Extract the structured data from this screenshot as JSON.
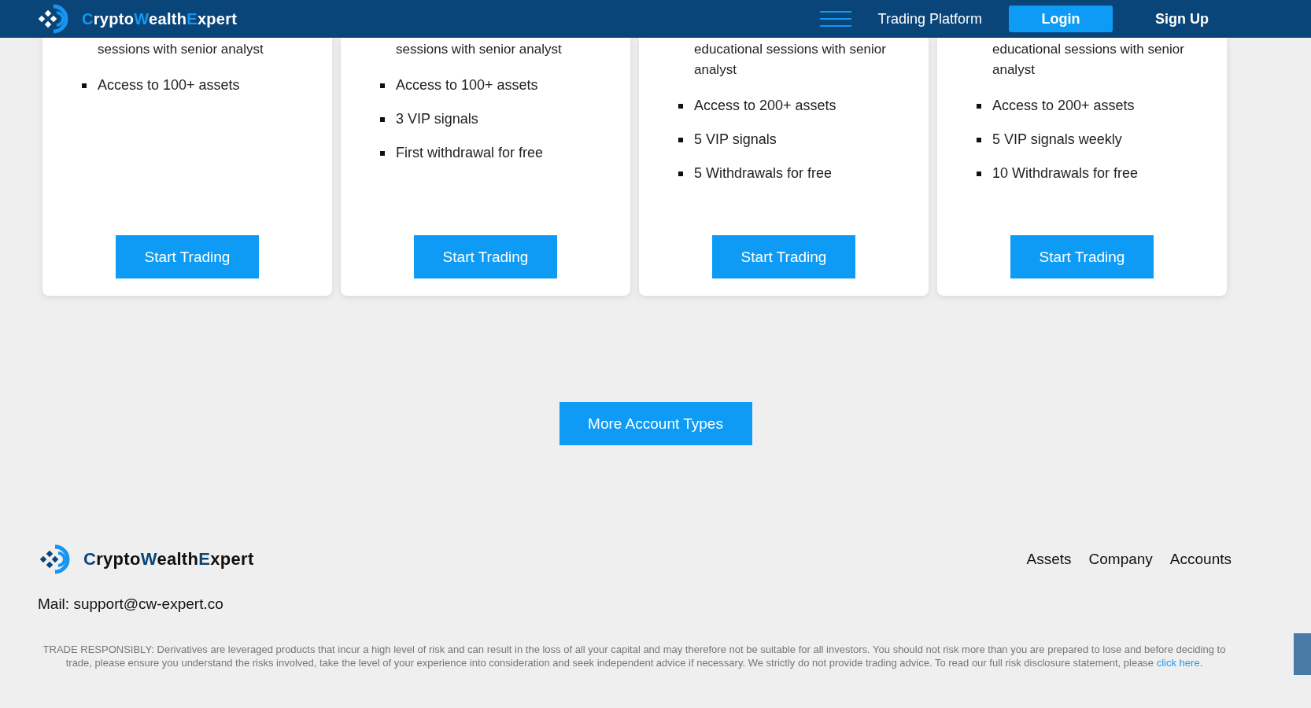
{
  "header": {
    "brand": {
      "parts": [
        "C",
        "rypto",
        "W",
        "ealth",
        "E",
        "xpert"
      ]
    },
    "nav": [
      {
        "label": "Trading Platform",
        "kind": "link"
      },
      {
        "label": "Login",
        "kind": "button"
      },
      {
        "label": "Sign Up",
        "kind": "link"
      }
    ]
  },
  "plans": [
    {
      "cut_text": "sessions with senior analyst",
      "features": [
        "Access to 100+ assets"
      ],
      "button": "Start Trading"
    },
    {
      "cut_text": "sessions with senior analyst",
      "features": [
        "Access to 100+ assets",
        "3 VIP signals",
        "First withdrawal for free"
      ],
      "button": "Start Trading"
    },
    {
      "cut_text": "educational sessions with senior analyst",
      "features": [
        "Access to 200+ assets",
        "5 VIP signals",
        "5 Withdrawals for free"
      ],
      "button": "Start Trading"
    },
    {
      "cut_text": "educational sessions with senior analyst",
      "features": [
        "Access to 200+ assets",
        "5 VIP signals weekly",
        "10 Withdrawals for free"
      ],
      "button": "Start Trading"
    }
  ],
  "more_button": "More Account Types",
  "footer": {
    "brand": {
      "parts": [
        "C",
        "rypto",
        "W",
        "ealth",
        "E",
        "xpert"
      ]
    },
    "links": [
      "Assets",
      "Company",
      "Accounts"
    ],
    "mail": "Mail: support@cw-expert.co",
    "disclaimer": "TRADE RESPONSIBLY: Derivatives are leveraged products that incur a high level of risk and can result in the loss of all your capital and may therefore not be suitable for all investors. You should not risk more than you are prepared to lose and before deciding to trade, please ensure you understand the risks involved, take the level of your experience into consideration and seek independent advice if necessary. We strictly do not provide trading advice. To read our full risk disclosure statement, please",
    "disclaimer_link": "click here",
    "disclaimer_end": "."
  }
}
